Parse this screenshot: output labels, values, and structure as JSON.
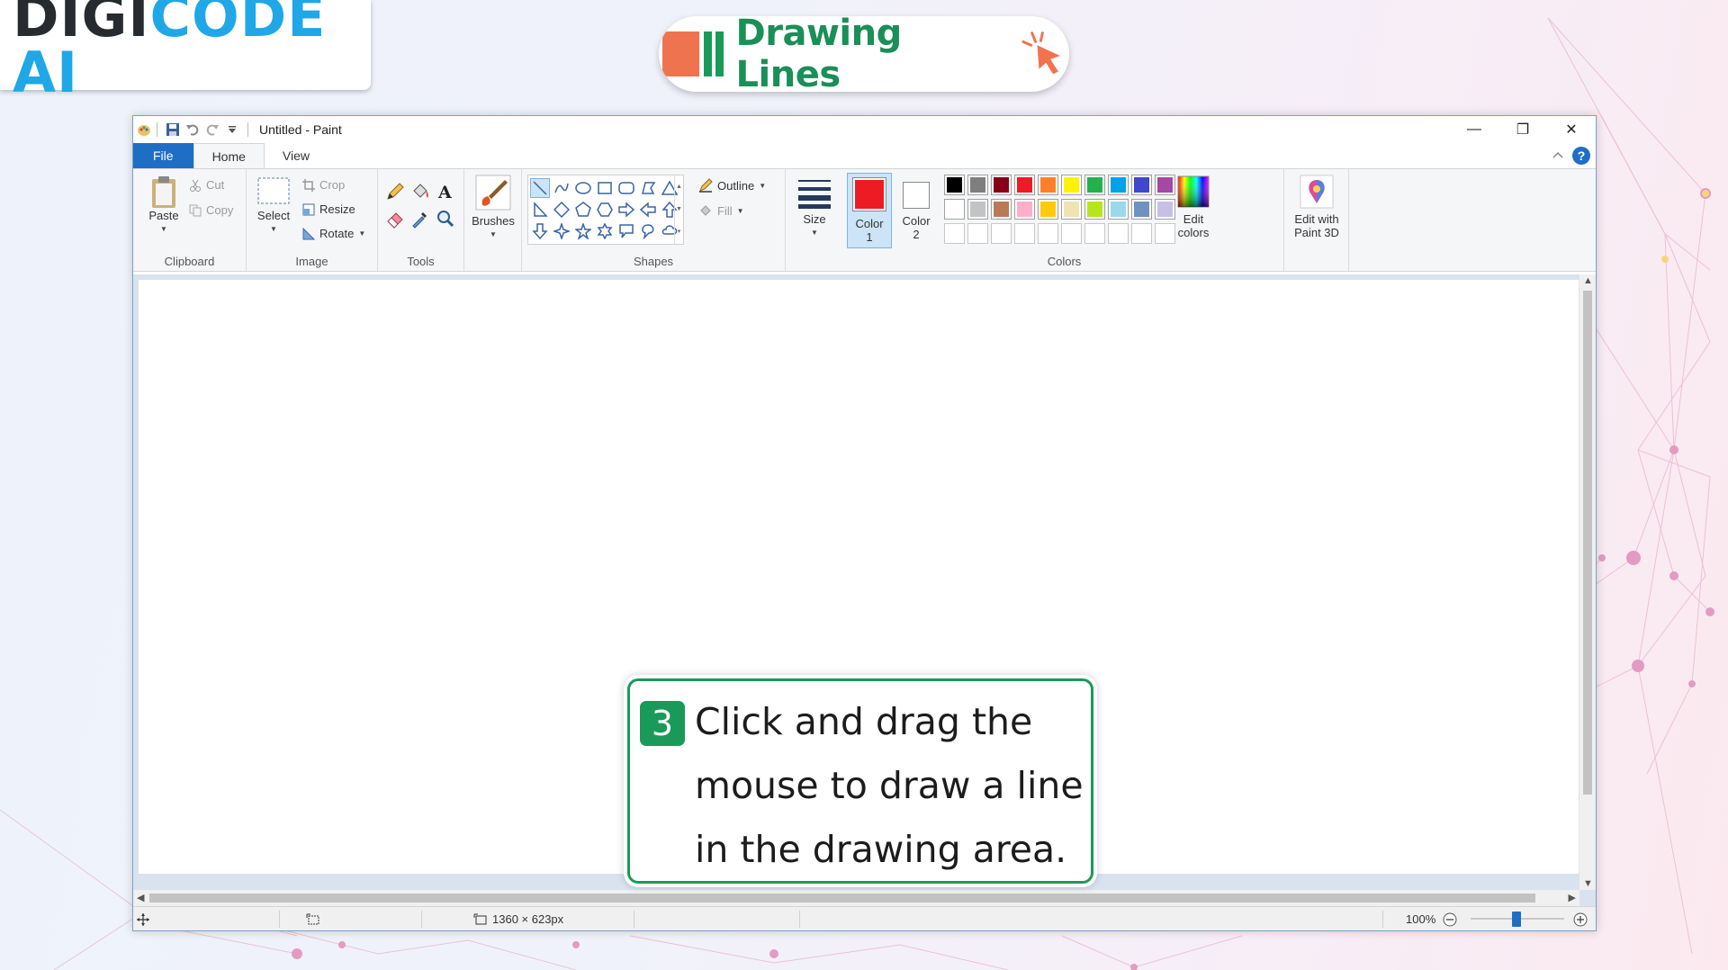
{
  "brand": {
    "logo_part1": "DIGI",
    "logo_part2": "CODE AI"
  },
  "lesson": {
    "title": "Drawing Lines"
  },
  "window": {
    "title": "Untitled - Paint",
    "controls": {
      "minimize": "—",
      "restore": "❐",
      "close": "✕"
    }
  },
  "tabs": {
    "file": "File",
    "home": "Home",
    "view": "View"
  },
  "ribbon": {
    "clipboard": {
      "label": "Clipboard",
      "paste": "Paste",
      "cut": "Cut",
      "copy": "Copy"
    },
    "image": {
      "label": "Image",
      "select": "Select",
      "crop": "Crop",
      "resize": "Resize",
      "rotate": "Rotate"
    },
    "tools": {
      "label": "Tools"
    },
    "brushes": {
      "label": "Brushes"
    },
    "shapes": {
      "label": "Shapes",
      "outline": "Outline",
      "fill": "Fill"
    },
    "size": {
      "label": "Size"
    },
    "colors": {
      "label": "Colors",
      "color1_line1": "Color",
      "color1_line2": "1",
      "color2_line1": "Color",
      "color2_line2": "2",
      "edit_colors_line1": "Edit",
      "edit_colors_line2": "colors",
      "color1_value": "#ed1c24",
      "color2_value": "#ffffff",
      "palette_row1": [
        "#000000",
        "#7f7f7f",
        "#880015",
        "#ed1c24",
        "#ff7f27",
        "#fff200",
        "#22b14c",
        "#00a2e8",
        "#3f48cc",
        "#a349a4"
      ],
      "palette_row2": [
        "#ffffff",
        "#c3c3c3",
        "#b97a57",
        "#ffaec9",
        "#ffc90e",
        "#efe4b0",
        "#b5e61d",
        "#99d9ea",
        "#7092be",
        "#c8bfe7"
      ],
      "palette_row3": [
        "#ffffff",
        "#ffffff",
        "#ffffff",
        "#ffffff",
        "#ffffff",
        "#ffffff",
        "#ffffff",
        "#ffffff",
        "#ffffff",
        "#ffffff"
      ]
    },
    "paint3d": {
      "line1": "Edit with",
      "line2": "Paint 3D"
    }
  },
  "statusbar": {
    "dimensions": "1360 × 623px",
    "zoom": "100%"
  },
  "callout": {
    "step": "3",
    "line1": "Click and drag the",
    "line2": "mouse to draw a line",
    "line3": "in the drawing area."
  }
}
